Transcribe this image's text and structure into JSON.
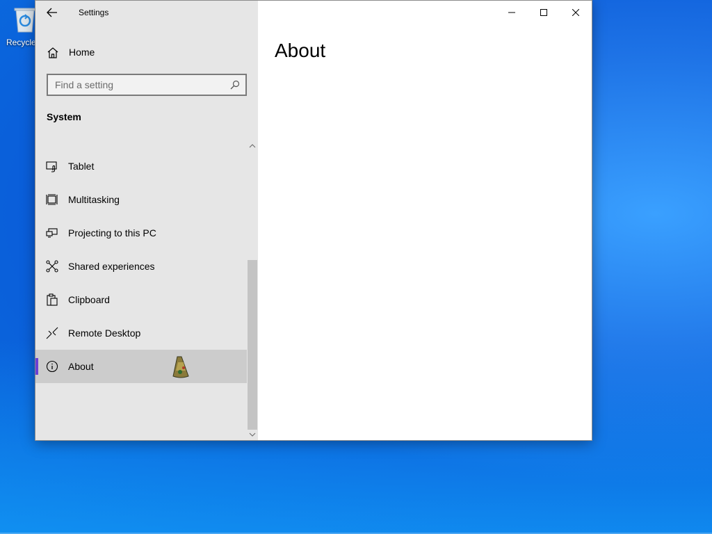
{
  "desktop": {
    "recycle_bin_label": "Recycle"
  },
  "window": {
    "title": "Settings",
    "controls": {
      "minimize_icon": "minimize-icon",
      "maximize_icon": "maximize-icon",
      "close_icon": "close-icon"
    }
  },
  "nav": {
    "home_label": "Home",
    "search_placeholder": "Find a setting",
    "section_title": "System",
    "items": [
      {
        "label": "Tablet",
        "icon": "tablet-icon",
        "selected": false
      },
      {
        "label": "Multitasking",
        "icon": "multitasking-icon",
        "selected": false
      },
      {
        "label": "Projecting to this PC",
        "icon": "projecting-icon",
        "selected": false
      },
      {
        "label": "Shared experiences",
        "icon": "shared-experiences-icon",
        "selected": false
      },
      {
        "label": "Clipboard",
        "icon": "clipboard-icon",
        "selected": false
      },
      {
        "label": "Remote Desktop",
        "icon": "remote-desktop-icon",
        "selected": false
      },
      {
        "label": "About",
        "icon": "info-icon",
        "selected": true
      }
    ]
  },
  "content": {
    "page_title": "About"
  },
  "colors": {
    "accent": "#6b3fd4",
    "nav_bg": "#e6e6e6",
    "selected_bg": "#cccccc",
    "desktop_blue": "#0a5ad8"
  }
}
